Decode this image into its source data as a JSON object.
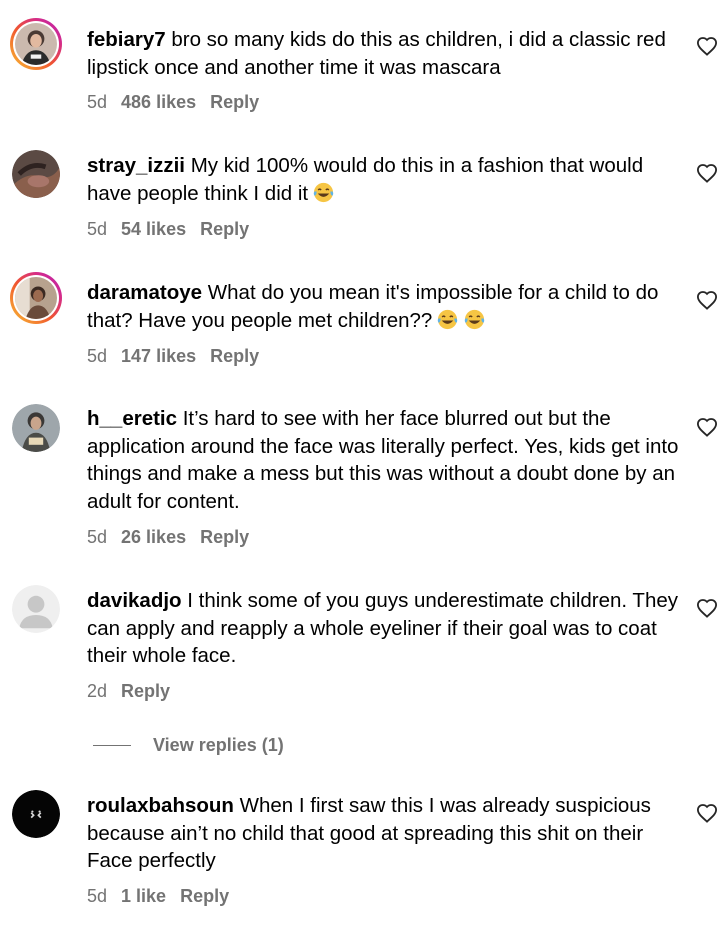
{
  "comments": [
    {
      "username": "febiary7",
      "text": "bro so many kids do this as children, i did a classic red lipstick once and another time it was mascara",
      "age": "5d",
      "likes": "486 likes",
      "reply": "Reply",
      "avatar": "story-ring-photo"
    },
    {
      "username": "stray_izzii",
      "text": "My kid 100% would do this in a fashion that would have people think I did it",
      "emoji": "face-with-tears-of-joy",
      "age": "5d",
      "likes": "54 likes",
      "reply": "Reply",
      "avatar": "photo"
    },
    {
      "username": "daramatoye",
      "text": "What do you mean it's impossible for a child to do that? Have you people met children??",
      "emoji": "face-with-tears-of-joy x2",
      "age": "5d",
      "likes": "147 likes",
      "reply": "Reply",
      "avatar": "story-ring-photo"
    },
    {
      "username": "h__eretic",
      "text": "It’s hard to see with her face blurred out but the application around the face was literally perfect. Yes, kids get into things and make a mess but this was without a doubt done by an adult for content.",
      "age": "5d",
      "likes": "26 likes",
      "reply": "Reply",
      "avatar": "photo"
    },
    {
      "username": "davikadjo",
      "text": "I think some of you guys underestimate children. They can apply and reapply a whole eyeliner if their goal was to coat their whole face.",
      "age": "2d",
      "reply": "Reply",
      "avatar": "default-person"
    },
    {
      "username": "roulaxbahsoun",
      "text": "When I first saw this I was already suspicious because ain’t no child that good at spreading this shit on their Face perfectly",
      "age": "5d",
      "likes": "1 like",
      "reply": "Reply",
      "avatar": "dark-photo"
    }
  ],
  "view_replies": "View replies (1)",
  "icons": {
    "like": "heart-outline-icon"
  },
  "colors": {
    "text": "#000000",
    "meta": "#737373"
  }
}
